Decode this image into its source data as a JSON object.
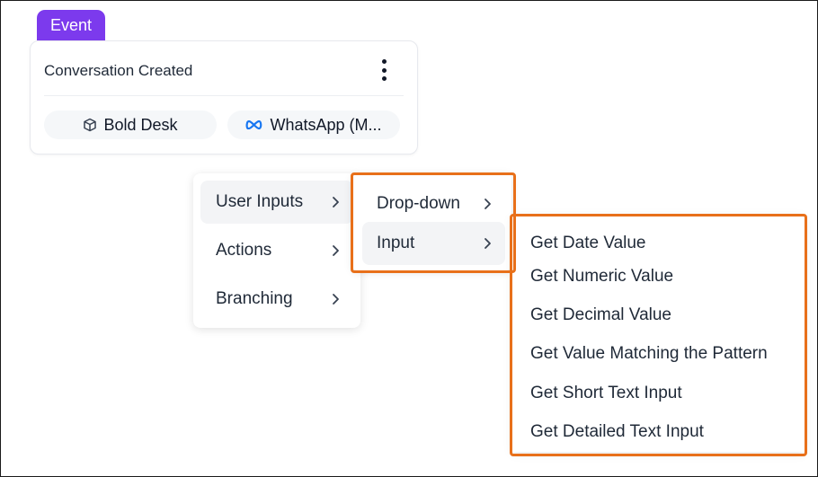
{
  "event_tag": "Event",
  "card": {
    "title": "Conversation Created",
    "chips": [
      {
        "label": "Bold Desk",
        "icon": "cube-icon"
      },
      {
        "label": "WhatsApp (M...",
        "icon": "meta-icon"
      }
    ]
  },
  "menu_level1": {
    "items": [
      {
        "label": "User Inputs",
        "active": true
      },
      {
        "label": "Actions",
        "active": false
      },
      {
        "label": "Branching",
        "active": false
      }
    ]
  },
  "menu_level2": {
    "items": [
      {
        "label": "Drop-down",
        "active": false
      },
      {
        "label": "Input",
        "active": true
      }
    ]
  },
  "menu_level3": {
    "items": [
      "Get Date Value",
      "Get Numeric Value",
      "Get Decimal Value",
      "Get Value Matching the Pattern",
      "Get Short Text Input",
      "Get Detailed Text Input"
    ]
  },
  "colors": {
    "event_tag_bg": "#7c3aed",
    "highlight": "#e8701a",
    "meta_blue": "#1877f2"
  }
}
